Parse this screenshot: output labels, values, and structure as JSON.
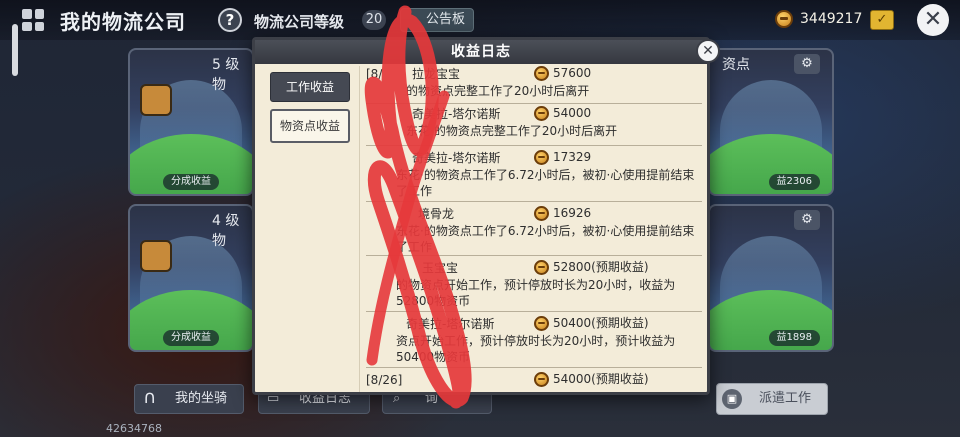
{
  "header": {
    "title": "我的物流公司",
    "level_label": "物流公司等级",
    "level_value": "20",
    "notice_label": "公告板",
    "coins": "3449217"
  },
  "cards": [
    {
      "title": "5 级物",
      "share": "分成收益"
    },
    {
      "title": "4 级物",
      "share": "分成收益"
    },
    {
      "title": "资点",
      "share": "益2306"
    },
    {
      "title": "",
      "share": "益1898"
    }
  ],
  "bottom": {
    "mount_label": "我的坐骑",
    "log_label": "收益日志",
    "third_label": "询",
    "dispatch_label": "派遣工作",
    "user_id": "42634768"
  },
  "modal": {
    "title": "收益日志",
    "tabs": [
      {
        "label": "工作收益"
      },
      {
        "label": "物资点收益"
      }
    ],
    "entries": [
      {
        "name": "[8/",
        "name2": "拉龙宝宝",
        "amount": "57600",
        "desc": "的物资点完整工作了20小时后离开"
      },
      {
        "name": "奇美拉-塔尔诺斯",
        "amount": "54000",
        "desc": "东花·的物资点完整工作了20小时后离开"
      },
      {
        "name": "奇美拉-塔尔诺斯",
        "amount": "17329",
        "desc": "东花·的物资点工作了6.72小时后，被初·心使用提前结束了工作"
      },
      {
        "name": "境骨龙",
        "amount": "16926",
        "desc": "东花·的物资点工作了6.72小时后，被初·心使用提前结束了工作"
      },
      {
        "name": "玉宝宝",
        "amount": "52800(预期收益)",
        "desc": "的物资点开始工作，预计停放时长为20小时，收益为52800物资币"
      },
      {
        "name": "奇美拉-塔尔诺斯",
        "amount": "50400(预期收益)",
        "desc": "资点开始工作，预计停放时长为20小时，预计收益为50400物资币"
      },
      {
        "name": "[8/26]",
        "amount": "54000(预期收益)",
        "desc": ""
      }
    ]
  },
  "colors": {
    "modal_bg": "#f3ecd9",
    "header_bg": "#3f434c",
    "scribble": "#e5383b"
  }
}
